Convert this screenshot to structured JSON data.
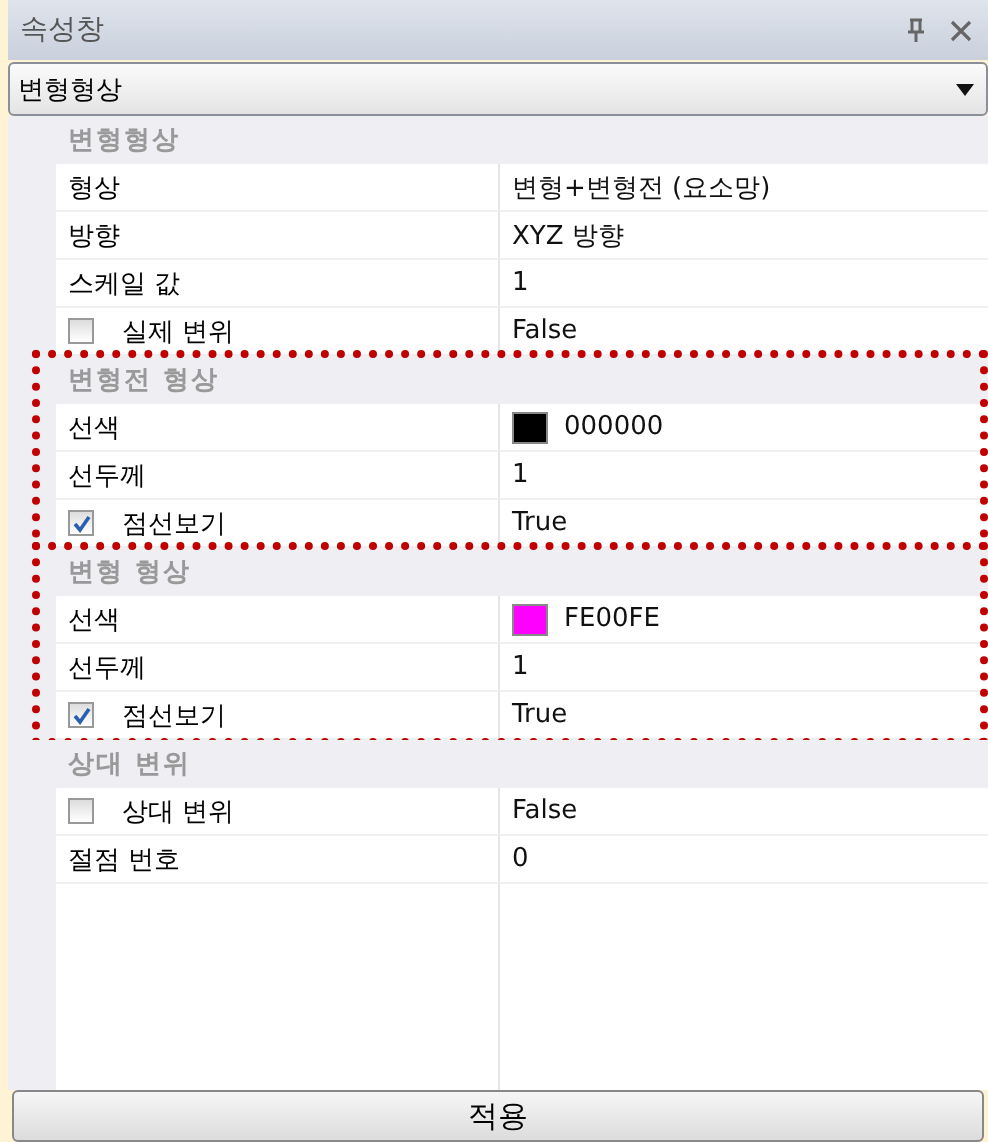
{
  "panel": {
    "title": "속성창"
  },
  "selector": {
    "value": "변형형상"
  },
  "categories": [
    {
      "title": "변형형상",
      "highlighted": false,
      "properties": [
        {
          "kind": "text",
          "name": "형상",
          "value": "변형+변형전 (요소망)"
        },
        {
          "kind": "text",
          "name": "방향",
          "value": "XYZ 방향"
        },
        {
          "kind": "text",
          "name": "스케일 값",
          "value": "1"
        },
        {
          "kind": "checkbox",
          "name": "실제 변위",
          "checked": false,
          "value": "False"
        }
      ]
    },
    {
      "title": "변형전 형상",
      "highlighted": true,
      "properties": [
        {
          "kind": "swatch",
          "name": "선색",
          "color": "#000000",
          "value": "000000"
        },
        {
          "kind": "text",
          "name": "선두께",
          "value": "1"
        },
        {
          "kind": "checkbox",
          "name": "점선보기",
          "checked": true,
          "value": "True"
        }
      ]
    },
    {
      "title": "변형 형상",
      "highlighted": true,
      "properties": [
        {
          "kind": "swatch",
          "name": "선색",
          "color": "#fe00fe",
          "value": "FE00FE"
        },
        {
          "kind": "text",
          "name": "선두께",
          "value": "1"
        },
        {
          "kind": "checkbox",
          "name": "점선보기",
          "checked": true,
          "value": "True"
        }
      ]
    },
    {
      "title": "상대 변위",
      "highlighted": false,
      "properties": [
        {
          "kind": "checkbox",
          "name": "상대 변위",
          "checked": false,
          "value": "False"
        },
        {
          "kind": "text",
          "name": "절점 번호",
          "value": "0"
        }
      ]
    }
  ],
  "apply_button": "적용"
}
